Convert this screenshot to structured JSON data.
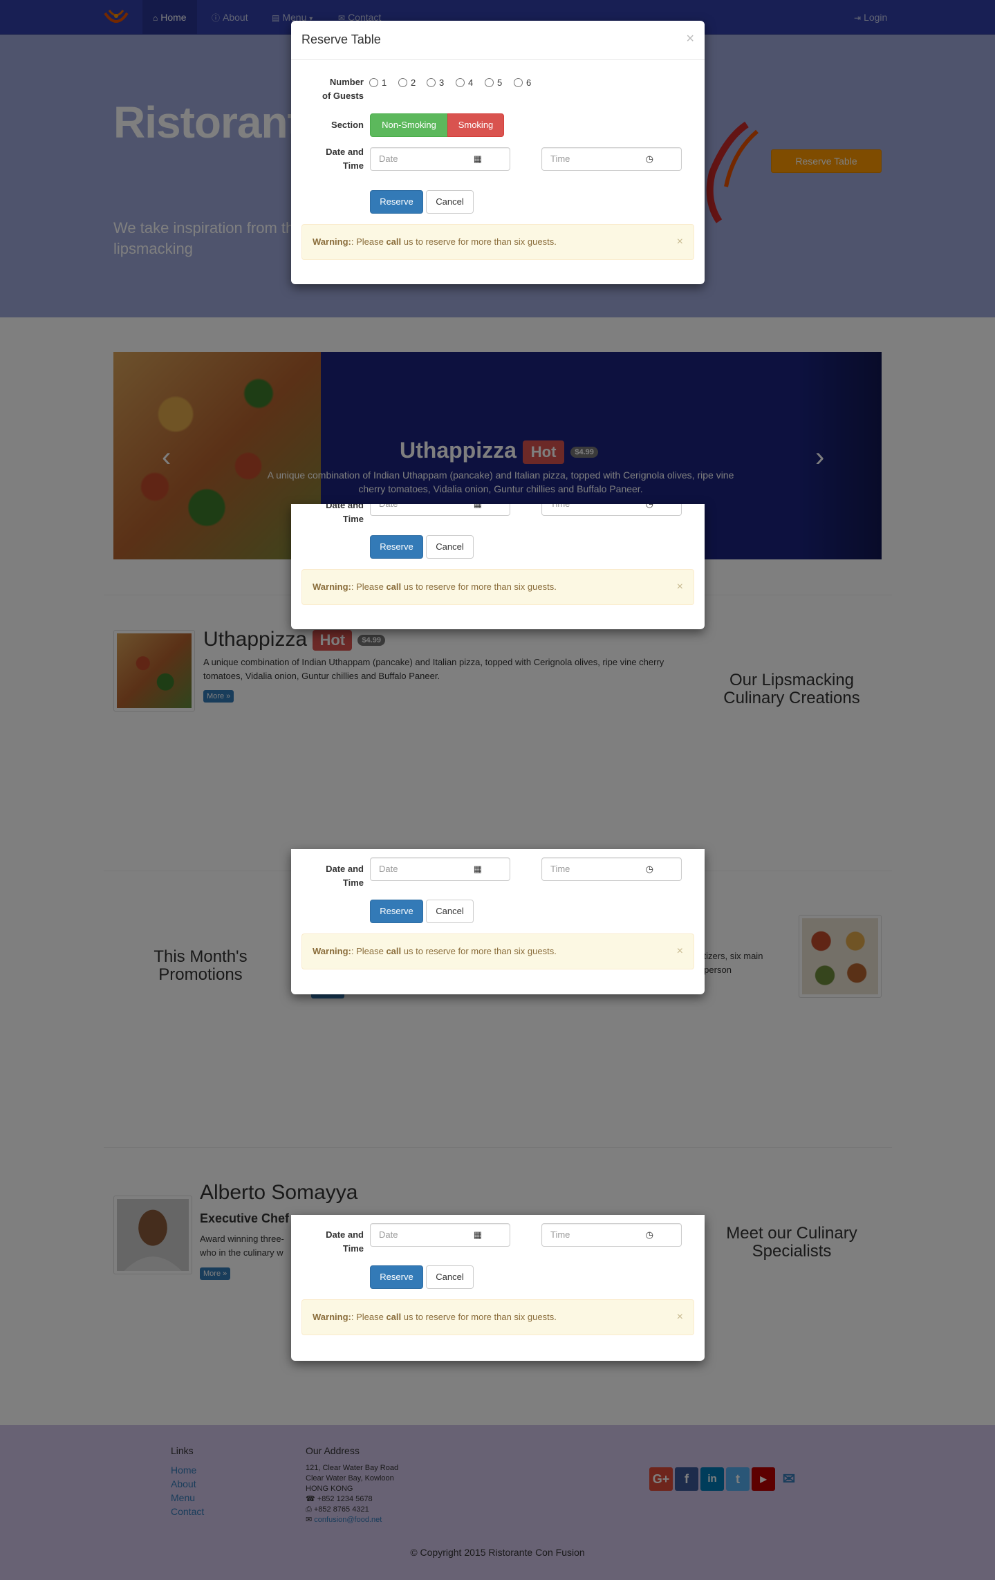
{
  "navbar": {
    "items": [
      {
        "label": "Home",
        "icon": "home-icon"
      },
      {
        "label": "About",
        "icon": "info-icon"
      },
      {
        "label": "Menu",
        "icon": "list-icon"
      },
      {
        "label": "Contact",
        "icon": "envelope-icon"
      }
    ],
    "login": "Login",
    "menu_caret": "▾"
  },
  "jumbotron": {
    "title": "Ristorante",
    "text": "We take inspiration from the experience. Our lipsmacking",
    "reserve_button": "Reserve Table"
  },
  "carousel": {
    "title": "Uthappizza",
    "badge": "Hot",
    "price": "$4.99",
    "description": "A unique combination of Indian Uthappam (pancake) and Italian pizza, topped with Cerignola olives, ripe vine cherry tomatoes, Vidalia onion, Guntur chillies and Buffalo Paneer.",
    "prev": "‹",
    "next": "›"
  },
  "dish": {
    "title": "Uthappizza",
    "badge": "Hot",
    "price": "$4.99",
    "description": "A unique combination of Indian Uthappam (pancake) and Italian pizza, topped with Cerignola olives, ripe vine cherry tomatoes, Vidalia onion, Guntur chillies and Buffalo Paneer.",
    "more": "More »",
    "side_title_1": "Our Lipsmacking",
    "side_title_2": "Culinary Creations"
  },
  "promotion": {
    "side_title_1": "This Month's",
    "side_title_2": "Promotions",
    "text_line_1": "petizers, six main",
    "text_line_2": "er person"
  },
  "chef": {
    "name": "Alberto Somayya",
    "role": "Executive Chef",
    "text_line_1": "Award winning three-",
    "text_line_2": "who in the culinary w",
    "more": "More »",
    "side_title_1": "Meet our Culinary",
    "side_title_2": "Specialists"
  },
  "modal": {
    "title": "Reserve Table",
    "close": "×",
    "guests_label_1": "Number",
    "guests_label_2": "of Guests",
    "guest_options": [
      "1",
      "2",
      "3",
      "4",
      "5",
      "6"
    ],
    "section_label": "Section",
    "non_smoking": "Non-Smoking",
    "smoking": "Smoking",
    "datetime_label_1": "Date and",
    "datetime_label_2": "Time",
    "date_placeholder": "Date",
    "time_placeholder": "Time",
    "reserve": "Reserve",
    "cancel": "Cancel",
    "warning_prefix": "Warning:",
    "warning_please": ": Please ",
    "warning_call": "call",
    "warning_rest": " us to reserve for more than six guests.",
    "alert_close": "×"
  },
  "footer": {
    "links_title": "Links",
    "links": [
      "Home",
      "About",
      "Menu",
      "Contact"
    ],
    "address_title": "Our Address",
    "address": [
      "121, Clear Water Bay Road",
      "Clear Water Bay, Kowloon",
      "HONG KONG"
    ],
    "phone": "+852 1234 5678",
    "fax": "+852 8765 4321",
    "email": "confusion@food.net",
    "copyright": "© Copyright 2015 Ristorante Con Fusion"
  },
  "colors": {
    "navbar": "#303fa8",
    "jumbotron": "#9fa8da",
    "carousel": "#1a237e",
    "footer": "#d1c4e9",
    "reserve_orange": "#ff9800"
  }
}
